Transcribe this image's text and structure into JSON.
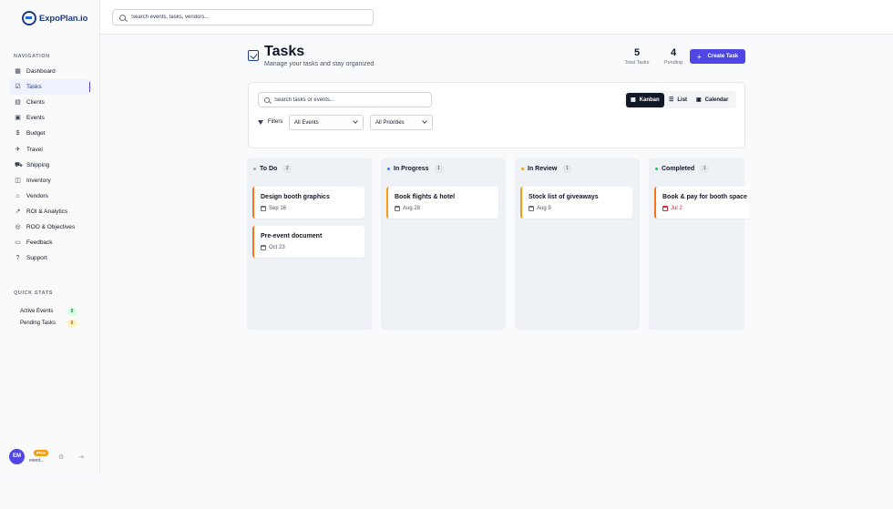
{
  "app": {
    "name": "ExpoPlan.io"
  },
  "global_search": {
    "placeholder": "Search events, tasks, vendors..."
  },
  "sidebar": {
    "navigation_label": "NAVIGATION",
    "items": [
      {
        "label": "Dashboard",
        "icon": "grid-icon",
        "active": false
      },
      {
        "label": "Tasks",
        "icon": "checkbox-icon",
        "active": true
      },
      {
        "label": "Clients",
        "icon": "building-icon",
        "active": false
      },
      {
        "label": "Events",
        "icon": "calendar-icon",
        "active": false
      },
      {
        "label": "Budget",
        "icon": "dollar-icon",
        "active": false
      },
      {
        "label": "Travel",
        "icon": "plane-icon",
        "active": false
      },
      {
        "label": "Shipping",
        "icon": "truck-icon",
        "active": false
      },
      {
        "label": "Inventory",
        "icon": "box-icon",
        "active": false
      },
      {
        "label": "Vendors",
        "icon": "store-icon",
        "active": false
      },
      {
        "label": "ROI & Analytics",
        "icon": "chart-icon",
        "active": false
      },
      {
        "label": "ROO & Objectives",
        "icon": "target-icon",
        "active": false
      },
      {
        "label": "Feedback",
        "icon": "message-icon",
        "active": false
      },
      {
        "label": "Support",
        "icon": "help-icon",
        "active": false
      }
    ],
    "quick_stats_label": "QUICK STATS",
    "quick_stats": [
      {
        "label": "Active Events",
        "value": "0",
        "color": "#dcfce7",
        "text_color": "#15803d"
      },
      {
        "label": "Pending Tasks",
        "value": "0",
        "color": "#fef3c7",
        "text_color": "#b45309"
      }
    ],
    "user": {
      "initials": "EM",
      "plan": "PRO",
      "subtitle": "event..."
    }
  },
  "header": {
    "title": "Tasks",
    "subtitle": "Manage your tasks and stay organized",
    "stats": [
      {
        "value": "5",
        "label": "Total Tasks"
      },
      {
        "value": "4",
        "label": "Pending"
      }
    ],
    "create_button": "Create Task"
  },
  "filters": {
    "search_placeholder": "Search tasks or events...",
    "filters_label": "Filters",
    "event_select": "All Events",
    "priority_select": "All Priorities",
    "views": [
      "Kanban",
      "List",
      "Calendar"
    ],
    "active_view": "Kanban"
  },
  "columns": [
    {
      "title": "To Do",
      "count": "2",
      "dot_color": "#9ca3af",
      "cards": [
        {
          "title": "Design booth graphics",
          "date": "Sep 16",
          "border": "#f97316",
          "overdue": false
        },
        {
          "title": "Pre-event document",
          "date": "Oct 23",
          "border": "#f97316",
          "overdue": false
        }
      ]
    },
    {
      "title": "In Progress",
      "count": "1",
      "dot_color": "#3b82f6",
      "cards": [
        {
          "title": "Book flights & hotel",
          "date": "Aug 28",
          "border": "#f59e0b",
          "overdue": false
        }
      ]
    },
    {
      "title": "In Review",
      "count": "1",
      "dot_color": "#f59e0b",
      "cards": [
        {
          "title": "Stock list of giveaways",
          "date": "Aug 9",
          "border": "#f59e0b",
          "overdue": false
        }
      ]
    },
    {
      "title": "Completed",
      "count": "1",
      "dot_color": "#22c55e",
      "cards": [
        {
          "title": "Book & pay for booth space",
          "date": "Jul 2",
          "border": "#f97316",
          "overdue": true
        }
      ]
    }
  ]
}
